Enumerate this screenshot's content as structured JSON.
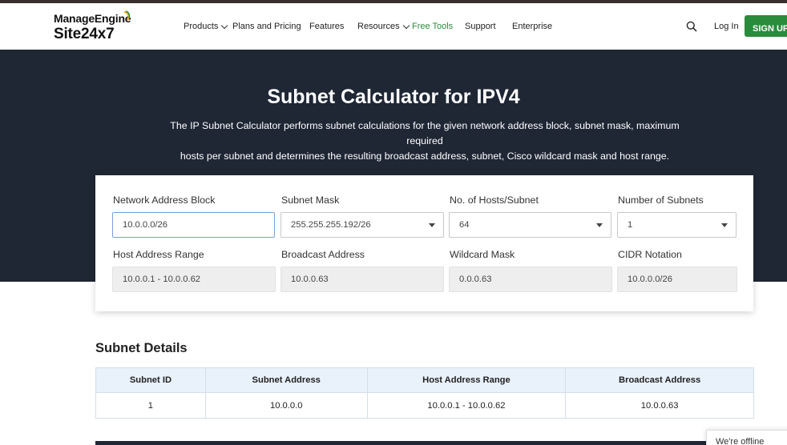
{
  "brand": {
    "line1": "ManageEngine",
    "line2": "Site24x7"
  },
  "nav": {
    "items": [
      {
        "label": "Products",
        "dropdown": true
      },
      {
        "label": "Plans and Pricing",
        "dropdown": false
      },
      {
        "label": "Features",
        "dropdown": false
      },
      {
        "label": "Resources",
        "dropdown": true
      },
      {
        "label": "Free Tools",
        "dropdown": false,
        "active": true
      },
      {
        "label": "Support",
        "dropdown": false
      },
      {
        "label": "Enterprise",
        "dropdown": false
      }
    ],
    "login": "Log In",
    "signup": "SIGN UP"
  },
  "hero": {
    "title": "Subnet Calculator for IPV4",
    "desc_line1": "The IP Subnet Calculator performs subnet calculations for the given network address block, subnet mask, maximum required",
    "desc_line2": "hosts per subnet and determines the resulting broadcast address, subnet, Cisco wildcard mask and host range."
  },
  "form": {
    "network_label": "Network Address Block",
    "network_value": "10.0.0.0/26",
    "mask_label": "Subnet Mask",
    "mask_value": "255.255.255.192/26",
    "hosts_label": "No. of Hosts/Subnet",
    "hosts_value": "64",
    "subnets_label": "Number of Subnets",
    "subnets_value": "1",
    "range_label": "Host Address Range",
    "range_value": "10.0.0.1 - 10.0.0.62",
    "broadcast_label": "Broadcast Address",
    "broadcast_value": "10.0.0.63",
    "wildcard_label": "Wildcard Mask",
    "wildcard_value": "0.0.0.63",
    "cidr_label": "CIDR Notation",
    "cidr_value": "10.0.0.0/26"
  },
  "details": {
    "title": "Subnet Details",
    "columns": [
      "Subnet ID",
      "Subnet Address",
      "Host Address Range",
      "Broadcast Address"
    ],
    "rows": [
      [
        "1",
        "10.0.0.0",
        "10.0.0.1 - 10.0.0.62",
        "10.0.0.63"
      ]
    ]
  },
  "chat": {
    "status": "We're offline"
  },
  "colors": {
    "accent": "#2b8b3c",
    "hero_bg": "#1f2735",
    "table_header_bg": "#e9f1fb"
  }
}
